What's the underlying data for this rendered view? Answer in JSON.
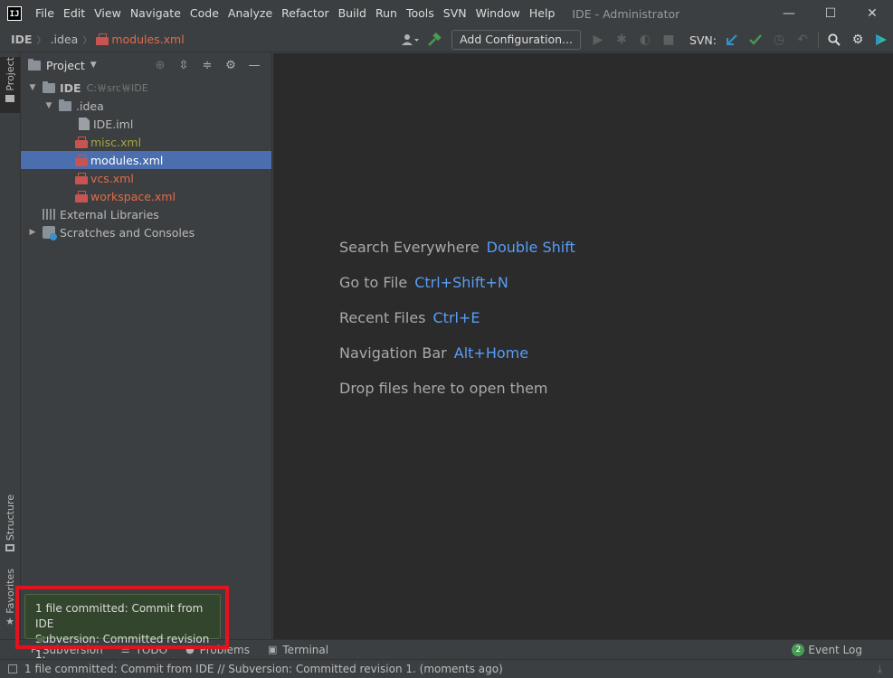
{
  "menu": [
    "File",
    "Edit",
    "View",
    "Navigate",
    "Code",
    "Analyze",
    "Refactor",
    "Build",
    "Run",
    "Tools",
    "SVN",
    "Window",
    "Help"
  ],
  "window_title": "IDE - Administrator",
  "window_controls": {
    "minimize": "—",
    "maximize": "☐",
    "close": "✕"
  },
  "breadcrumbs": [
    "IDE",
    ".idea",
    "modules.xml"
  ],
  "toolbar": {
    "add_configuration": "Add Configuration...",
    "svn_label": "SVN:"
  },
  "left_stripe": {
    "project": "Project",
    "structure": "Structure",
    "favorites": "Favorites"
  },
  "project_panel": {
    "title": "Project",
    "root": {
      "name": "IDE",
      "path": "C:￦src￦IDE"
    },
    "idea_folder": ".idea",
    "files": [
      {
        "name": "IDE.iml",
        "status": "normal"
      },
      {
        "name": "misc.xml",
        "status": "modified"
      },
      {
        "name": "modules.xml",
        "status": "selected"
      },
      {
        "name": "vcs.xml",
        "status": "unversioned"
      },
      {
        "name": "workspace.xml",
        "status": "unversioned"
      }
    ],
    "external_libraries": "External Libraries",
    "scratches": "Scratches and Consoles"
  },
  "editor_hints": [
    {
      "label": "Search Everywhere",
      "key": "Double Shift"
    },
    {
      "label": "Go to File",
      "key": "Ctrl+Shift+N"
    },
    {
      "label": "Recent Files",
      "key": "Ctrl+E"
    },
    {
      "label": "Navigation Bar",
      "key": "Alt+Home"
    },
    {
      "label": "Drop files here to open them",
      "key": ""
    }
  ],
  "bottom_tabs": [
    "Subversion",
    "TODO",
    "Problems",
    "Terminal"
  ],
  "event_log": {
    "label": "Event Log",
    "count": "2"
  },
  "notification": {
    "line1": "1 file committed: Commit from IDE",
    "line2": "Subversion: Committed revision 1."
  },
  "status_text": "1 file committed: Commit from IDE // Subversion: Committed revision 1. (moments ago)",
  "colors": {
    "accent": "#589df6",
    "selection": "#4b6eaf",
    "highlight": "#e0141e",
    "modified": "#a5a53b",
    "unversioned": "#e06c4b"
  }
}
